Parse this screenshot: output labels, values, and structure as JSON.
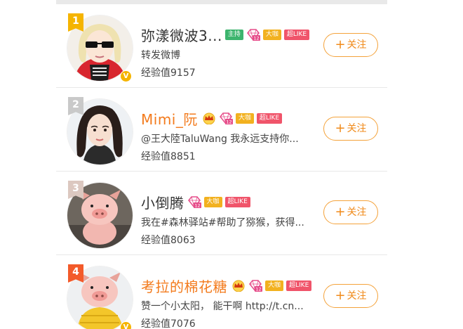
{
  "follow_label": "关注",
  "follow_plus": "+",
  "colors": {
    "accent": "#f08a1a",
    "rank_top": "#f5b400",
    "rank_other": "#c9c9c9",
    "rank_fourth": "#f35a2a"
  },
  "users": [
    {
      "rank": "1",
      "name": "弥漾微波3...",
      "tags": [
        "主持",
        "大咖",
        "超LIKE"
      ],
      "gem_level": "12",
      "description": "转发微博",
      "experience": "经验值9157",
      "verified": "V"
    },
    {
      "rank": "2",
      "name": "Mimi_阮",
      "tags": [
        "大咖",
        "超LIKE"
      ],
      "gem_level": "12",
      "description": "@王大陸TaluWang 我永远支持你...",
      "experience": "经验值8851"
    },
    {
      "rank": "3",
      "name": "小倒腾",
      "tags": [
        "大咖",
        "超LIKE"
      ],
      "gem_level": "12",
      "description": "我在#森林驿站#帮助了猕猴，获得...",
      "experience": "经验值8063"
    },
    {
      "rank": "4",
      "name": "考拉的棉花糖",
      "tags": [
        "大咖",
        "超LIKE"
      ],
      "gem_level": "12",
      "description": "赞一个小太阳， 能干啊 http://t.cn...",
      "experience": "经验值7076",
      "verified": "V"
    }
  ]
}
